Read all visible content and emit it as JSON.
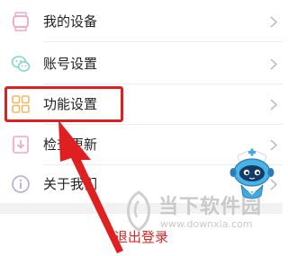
{
  "menu": {
    "items": [
      {
        "label": "我的设备",
        "icon": "watch-icon"
      },
      {
        "label": "账号设置",
        "icon": "wechat-icon"
      },
      {
        "label": "功能设置",
        "icon": "grid-icon"
      },
      {
        "label": "检查更新",
        "icon": "download-icon"
      },
      {
        "label": "关于我们",
        "icon": "info-icon"
      }
    ]
  },
  "logout": {
    "label": "退出登录"
  },
  "watermark": {
    "title": "当下软件园",
    "url": "www.downxia.com"
  },
  "colors": {
    "highlight": "#e02020",
    "logout_text": "#e02424",
    "icon_pink": "#f2a7bd",
    "icon_teal": "#7fd6c6",
    "icon_orange": "#f4b860",
    "icon_purple": "#b7a6dc"
  }
}
